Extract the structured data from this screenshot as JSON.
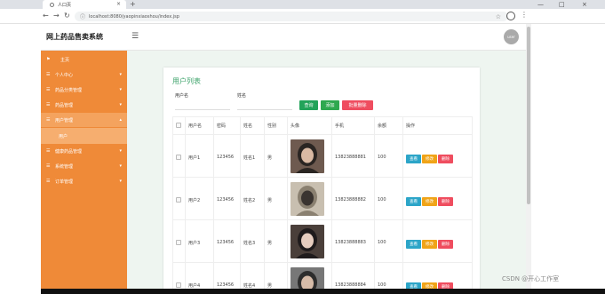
{
  "browser": {
    "tab_title": "人口页",
    "tab_close": "×",
    "new_tab": "+",
    "url": "localhost:8080/yaopinxiaoshou/index.jsp",
    "controls": [
      "—",
      "□",
      "×"
    ]
  },
  "header": {
    "brand": "网上药品售卖系统",
    "avatar_text": "user"
  },
  "sidebar": {
    "items": [
      {
        "label": "主页",
        "icon": "flag-icon"
      },
      {
        "label": "个人中心",
        "icon": "menu-icon"
      },
      {
        "label": "药品分类管理",
        "icon": "menu-icon"
      },
      {
        "label": "药品管理",
        "icon": "menu-icon"
      },
      {
        "label": "用户管理",
        "icon": "menu-icon"
      },
      {
        "label": "健康药品管理",
        "icon": "menu-icon"
      },
      {
        "label": "系统管理",
        "icon": "menu-icon"
      },
      {
        "label": "订单管理",
        "icon": "menu-icon"
      }
    ],
    "sub_item": "用户"
  },
  "main": {
    "title": "用户列表",
    "search": {
      "username_label": "用户名",
      "name_label": "姓名",
      "username_value": "",
      "name_value": ""
    },
    "buttons": {
      "search": "查询",
      "add": "添加",
      "batch_delete": "批量删除"
    },
    "columns": [
      "用户名",
      "密码",
      "姓名",
      "性别",
      "头像",
      "手机",
      "余额",
      "操作"
    ],
    "rows": [
      {
        "username": "用户1",
        "password": "123456",
        "name": "姓名1",
        "gender": "男",
        "phone": "13823888881",
        "balance": "100"
      },
      {
        "username": "用户2",
        "password": "123456",
        "name": "姓名2",
        "gender": "男",
        "phone": "13823888882",
        "balance": "100"
      },
      {
        "username": "用户3",
        "password": "123456",
        "name": "姓名3",
        "gender": "男",
        "phone": "13823888883",
        "balance": "100"
      },
      {
        "username": "用户4",
        "password": "123456",
        "name": "姓名4",
        "gender": "男",
        "phone": "13823888884",
        "balance": "100"
      }
    ],
    "row_actions": {
      "view": "查看",
      "edit": "修改",
      "delete": "删除"
    }
  },
  "watermark": "CSDN @开心工作室",
  "colors": {
    "sidebar": "#ef8a38",
    "title_green": "#3ea36b",
    "view": "#2ca5c8",
    "edit": "#f0a418",
    "delete": "#ef4d5f"
  }
}
